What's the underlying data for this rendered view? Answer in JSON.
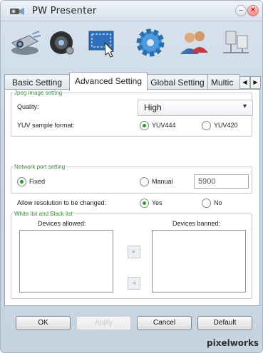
{
  "window": {
    "title": "PW Presenter",
    "min_glyph": "–",
    "close_glyph": "✕"
  },
  "toolbar": {
    "icons": [
      "projector-icon",
      "webcam-icon",
      "screen-capture-icon",
      "gear-icon",
      "users-icon",
      "network-icon"
    ]
  },
  "tabs": {
    "items": [
      "Basic Setting",
      "Advanced Setting",
      "Global Setting",
      "Multic"
    ],
    "active": "Advanced Setting",
    "scroll_left": "◀",
    "scroll_right": "▶"
  },
  "jpeg": {
    "legend": "Jpeg image setting",
    "quality_label": "Quality:",
    "quality_value": "High",
    "yuv_label": "YUV sample format:",
    "yuv444": "YUV444",
    "yuv420": "YUV420",
    "yuv_selected": "YUV444"
  },
  "network": {
    "legend": "Network port setting",
    "fixed": "Fixed",
    "manual": "Manual",
    "port": "5900",
    "selected": "Fixed",
    "resolution_label": "Allow resolution to be changed:",
    "yes": "Yes",
    "no": "No",
    "resolution_selected": "Yes"
  },
  "lists": {
    "legend": "White list and Black list",
    "allowed_label": "Devices allowed:",
    "banned_label": "Devices banned:",
    "move_right": "►",
    "move_left": "◄"
  },
  "footer": {
    "ok": "OK",
    "apply": "Apply",
    "cancel": "Cancel",
    "default": "Default",
    "brand": "pixelworks"
  },
  "colors": {
    "accent_green": "#3d8a3a",
    "radio_dot": "#2a9a2a"
  }
}
